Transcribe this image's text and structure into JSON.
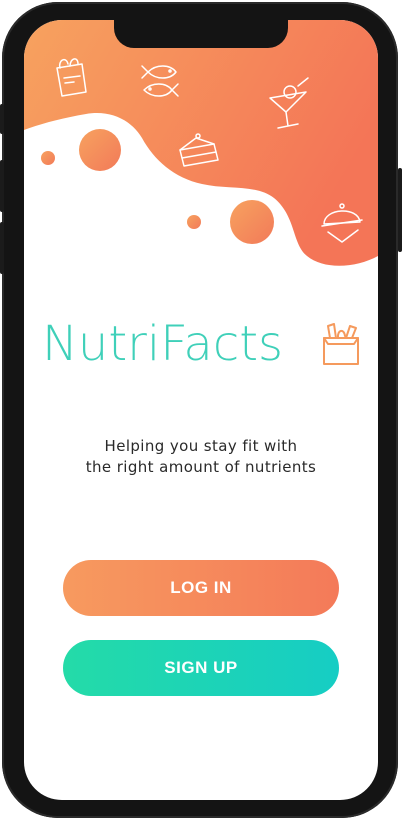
{
  "app": {
    "name": "NutriFacts",
    "tagline_line1": "Helping you stay fit with",
    "tagline_line2": "the right amount of nutrients"
  },
  "actions": {
    "login_label": "LOG IN",
    "signup_label": "SIGN UP"
  },
  "colors": {
    "brand_teal": "#3fd0b9",
    "header_orange_start": "#f7a25f",
    "header_orange_end": "#f47557",
    "signup_start": "#24dba8",
    "signup_end": "#16cdc4"
  },
  "icons": [
    "grocery-bag-icon",
    "fish-icon",
    "cocktail-icon",
    "cake-slice-icon",
    "cloche-icon"
  ]
}
